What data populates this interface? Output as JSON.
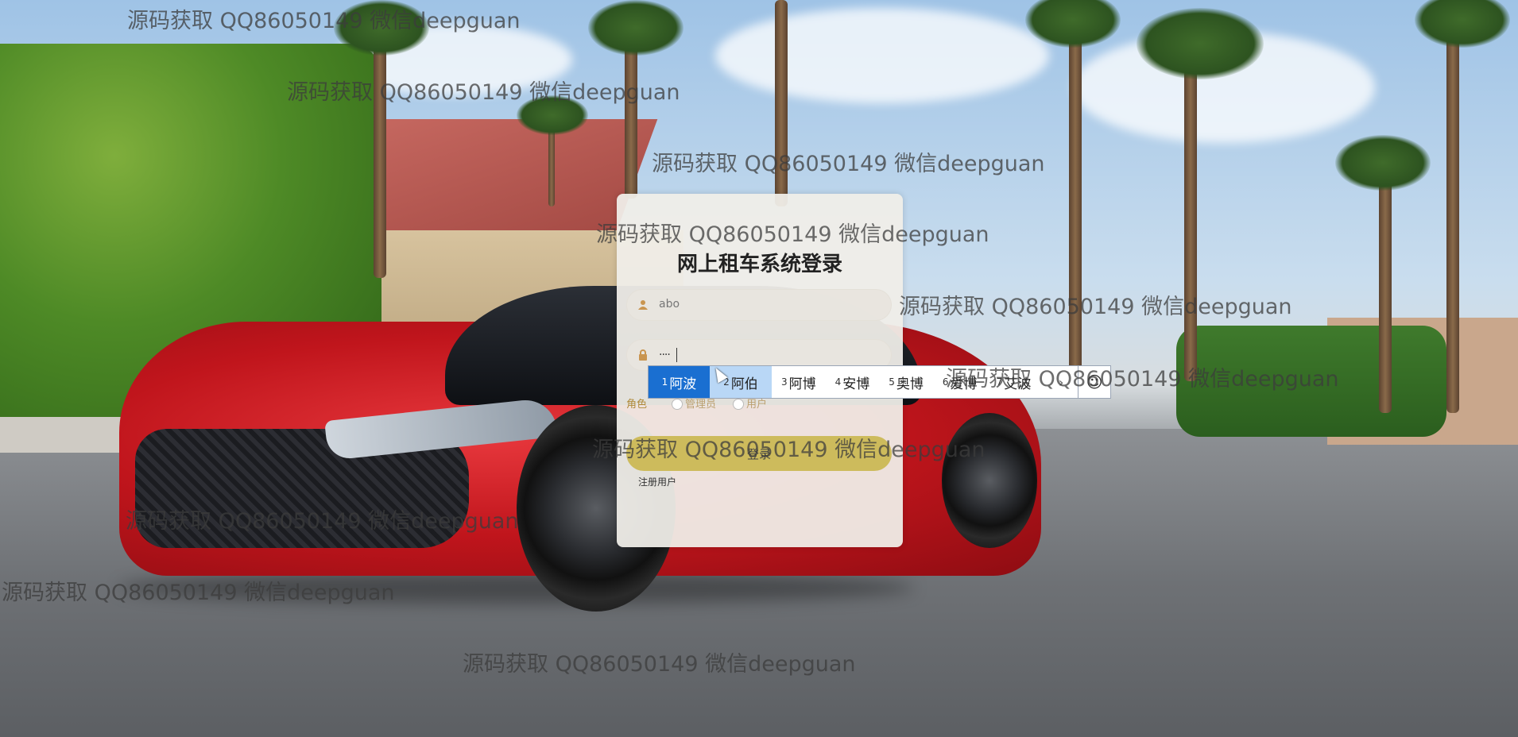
{
  "login": {
    "title": "网上租车系统登录",
    "username_value": "abo",
    "password_value": "····",
    "role_label": "角色",
    "role_options": [
      "管理员",
      "用户"
    ],
    "login_button": "登录",
    "register_link": "注册用户"
  },
  "ime": {
    "candidates": [
      {
        "num": "1",
        "text": "阿波"
      },
      {
        "num": "2",
        "text": "阿伯"
      },
      {
        "num": "3",
        "text": "阿博"
      },
      {
        "num": "4",
        "text": "安博"
      },
      {
        "num": "5",
        "text": "奥博"
      },
      {
        "num": "6",
        "text": "爱博"
      },
      {
        "num": "7",
        "text": "艾波"
      }
    ],
    "emoji": "☺",
    "next_arrow": "›"
  },
  "watermark": {
    "text": "源码获取 QQ86050149 微信deepguan"
  },
  "colors": {
    "login_button": "#cdbb5c",
    "ime_active": "#1a6fd1",
    "ime_hover": "#b9d7f6"
  }
}
